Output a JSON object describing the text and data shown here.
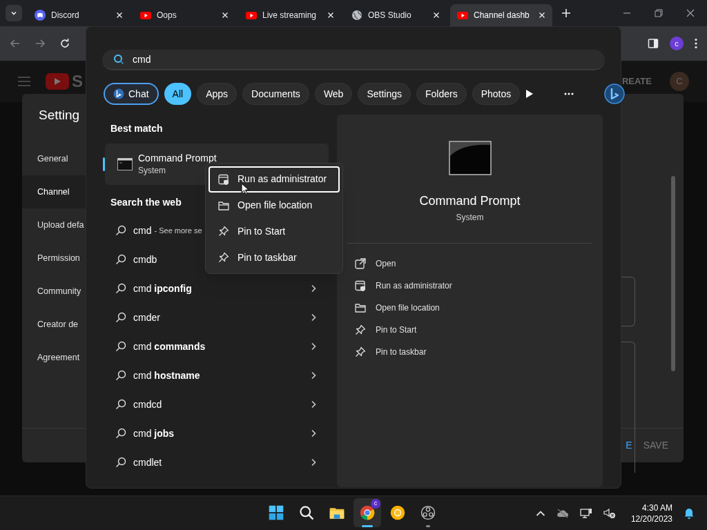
{
  "browser": {
    "tabs": [
      {
        "title": "Discord",
        "kind": "discord",
        "selected": false
      },
      {
        "title": "Oops",
        "kind": "youtube",
        "selected": false
      },
      {
        "title": "Live streaming",
        "kind": "youtube",
        "selected": false
      },
      {
        "title": "OBS Studio",
        "kind": "globe",
        "selected": false
      },
      {
        "title": "Channel dashb",
        "kind": "youtube",
        "selected": true
      }
    ],
    "profile": "c"
  },
  "studio": {
    "logo_text": "S",
    "create_label": "REATE",
    "avatar": "C"
  },
  "settings": {
    "title": "Setting",
    "nav": [
      {
        "label": "General",
        "selected": false
      },
      {
        "label": "Channel",
        "selected": true
      },
      {
        "label": "Upload defa",
        "selected": false
      },
      {
        "label": "Permission",
        "selected": false
      },
      {
        "label": "Community",
        "selected": false
      },
      {
        "label": "Creator de",
        "selected": false
      },
      {
        "label": "Agreement",
        "selected": false
      }
    ],
    "close_label": "E",
    "save_label": "SAVE"
  },
  "search": {
    "query": "cmd",
    "filters": [
      {
        "label": "Chat",
        "kind": "chat",
        "selected": false
      },
      {
        "label": "All",
        "kind": "filter",
        "selected": true
      },
      {
        "label": "Apps",
        "kind": "filter",
        "selected": false
      },
      {
        "label": "Documents",
        "kind": "filter",
        "selected": false
      },
      {
        "label": "Web",
        "kind": "filter",
        "selected": false
      },
      {
        "label": "Settings",
        "kind": "filter",
        "selected": false
      },
      {
        "label": "Folders",
        "kind": "filter",
        "selected": false
      },
      {
        "label": "Photos",
        "kind": "filter",
        "selected": false
      }
    ],
    "best_match": {
      "heading": "Best match",
      "title": "Command Prompt",
      "subtitle": "System",
      "selected": true
    },
    "web": {
      "heading": "Search the web",
      "items": [
        {
          "text": "cmd",
          "note": "- See more se"
        },
        {
          "text": "cmdb"
        },
        {
          "text": "cmd **ipconfig**",
          "chevron": true
        },
        {
          "text": "cmder",
          "chevron": true
        },
        {
          "text": "cmd **commands**",
          "chevron": true
        },
        {
          "text": "cmd **hostname**",
          "chevron": true
        },
        {
          "text": "cmdcd",
          "chevron": true
        },
        {
          "text": "cmd **jobs**",
          "chevron": true
        },
        {
          "text": "cmdlet",
          "chevron": true
        }
      ]
    },
    "details": {
      "title": "Command Prompt",
      "subtitle": "System",
      "actions": [
        {
          "label": "Open",
          "kind": "open"
        },
        {
          "label": "Run as administrator",
          "kind": "admin"
        },
        {
          "label": "Open file location",
          "kind": "folder"
        },
        {
          "label": "Pin to Start",
          "kind": "pin"
        },
        {
          "label": "Pin to taskbar",
          "kind": "pin"
        }
      ]
    }
  },
  "context_menu": {
    "items": [
      {
        "label": "Run as administrator",
        "kind": "admin",
        "focused": true
      },
      {
        "label": "Open file location",
        "kind": "folder",
        "focused": false
      },
      {
        "label": "Pin to Start",
        "kind": "pin",
        "focused": false
      },
      {
        "label": "Pin to taskbar",
        "kind": "pin",
        "focused": false
      }
    ]
  },
  "taskbar": {
    "apps": [
      {
        "kind": "start",
        "selected": false,
        "running": false
      },
      {
        "kind": "search",
        "selected": false,
        "running": false
      },
      {
        "kind": "explorer",
        "selected": false,
        "running": false
      },
      {
        "kind": "chrome",
        "selected": true,
        "running": true,
        "badge": "c"
      },
      {
        "kind": "canary",
        "selected": false,
        "running": false
      },
      {
        "kind": "obs",
        "selected": false,
        "running": true
      }
    ],
    "time": "4:30 AM",
    "date": "12/20/2023"
  }
}
